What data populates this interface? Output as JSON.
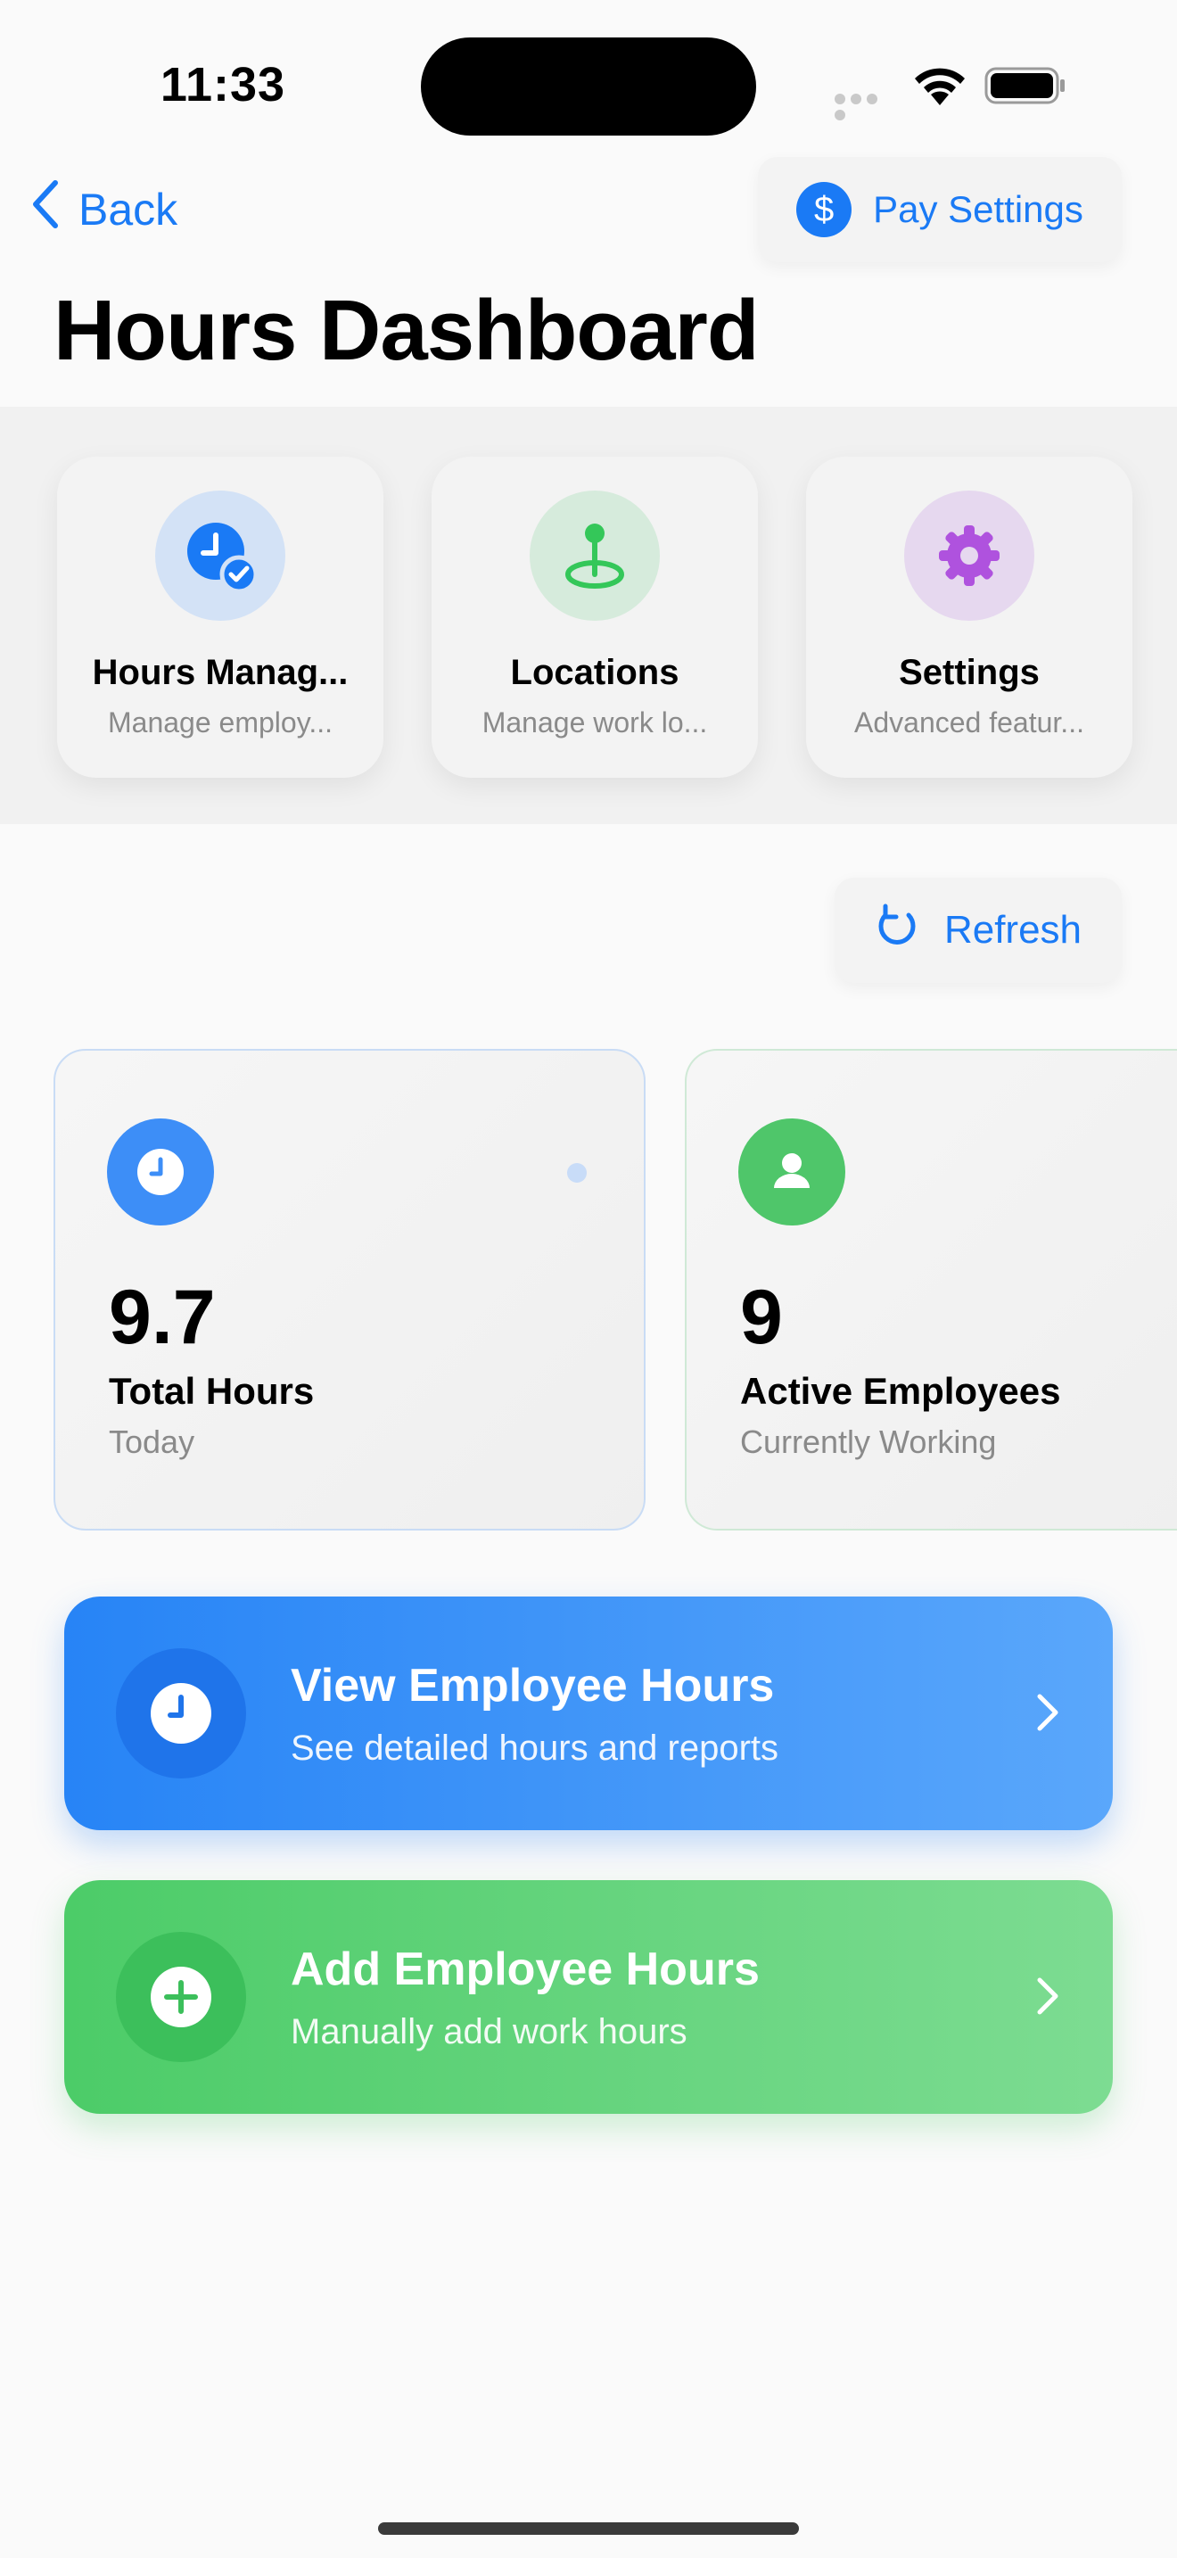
{
  "status_bar": {
    "time": "11:33"
  },
  "nav": {
    "back_label": "Back",
    "pay_settings_label": "Pay Settings",
    "pay_icon_glyph": "$"
  },
  "page": {
    "title": "Hours Dashboard"
  },
  "quick_access": [
    {
      "title": "Hours Manag...",
      "subtitle": "Manage employ...",
      "icon": "clock-check-icon",
      "color": "#1a7af5",
      "bg": "#d3e2f6"
    },
    {
      "title": "Locations",
      "subtitle": "Manage work lo...",
      "icon": "location-pin-icon",
      "color": "#34c759",
      "bg": "#d6ebdc"
    },
    {
      "title": "Settings",
      "subtitle": "Advanced featur...",
      "icon": "gear-icon",
      "color": "#af52de",
      "bg": "#e6d8ef"
    }
  ],
  "refresh_label": "Refresh",
  "stats": [
    {
      "value": "9.7",
      "label": "Total Hours",
      "sub": "Today",
      "icon": "clock-icon",
      "color": "#3d8ef7"
    },
    {
      "value": "9",
      "label": "Active Employees",
      "sub": "Currently Working",
      "icon": "person-icon",
      "color": "#4fc66a"
    }
  ],
  "actions": [
    {
      "title": "View Employee Hours",
      "subtitle": "See detailed hours and reports",
      "icon": "clock-icon",
      "color": "#2d86f6"
    },
    {
      "title": "Add Employee Hours",
      "subtitle": "Manually add work hours",
      "icon": "plus-icon",
      "color": "#4ccc68"
    }
  ],
  "colors": {
    "accent": "#1a7af5",
    "green": "#34c759",
    "purple": "#af52de"
  }
}
